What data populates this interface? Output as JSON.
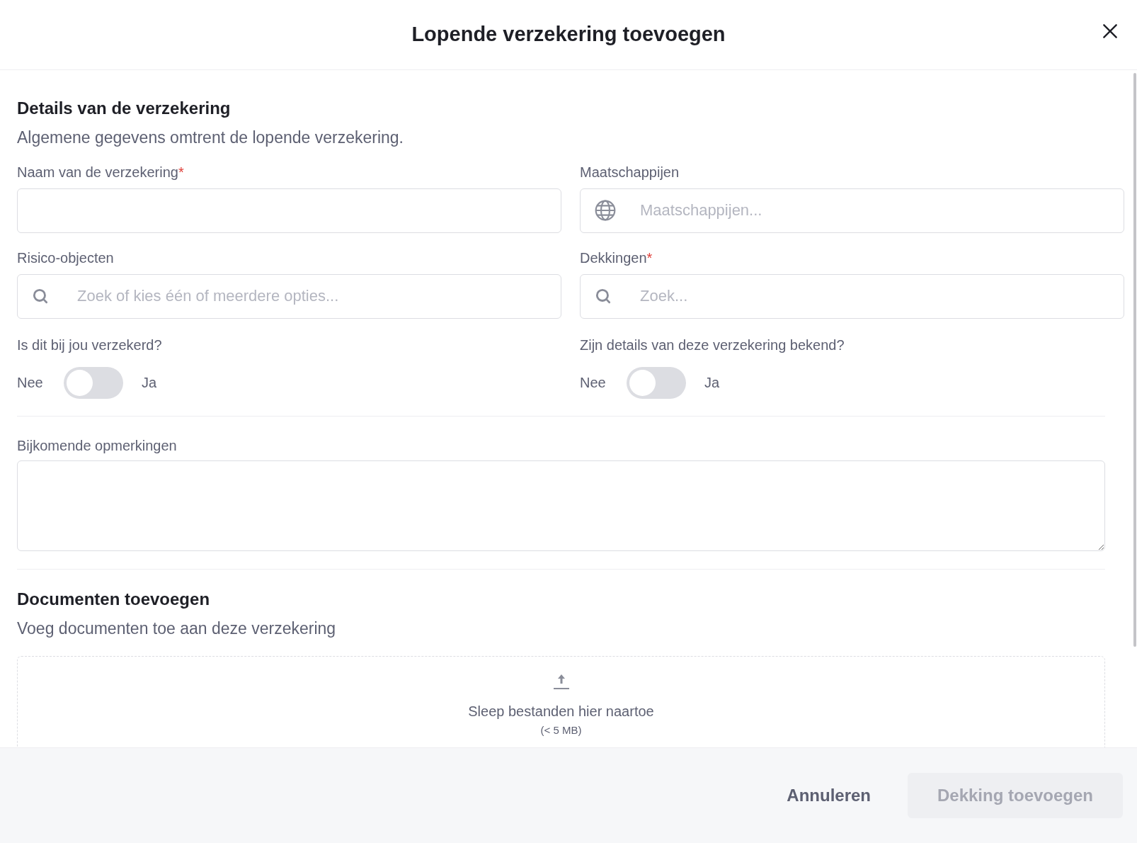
{
  "dialog": {
    "title": "Lopende verzekering toevoegen"
  },
  "details": {
    "title": "Details van de verzekering",
    "subtitle": "Algemene gegevens omtrent de lopende verzekering.",
    "fields": [
      {
        "kind": "text",
        "label": "Naam van de verzekering",
        "required_mark": "*"
      },
      {
        "kind": "globe",
        "label": "Maatschappijen",
        "placeholder": "Maatschappijen..."
      },
      {
        "kind": "search",
        "label": "Risico-objecten",
        "placeholder": "Zoek of kies één of meerdere opties..."
      },
      {
        "kind": "search",
        "label": "Dekkingen",
        "required_mark": "*",
        "placeholder": "Zoek..."
      }
    ],
    "toggles": [
      {
        "question": "Is dit bij jou verzekerd?",
        "off_label": "Nee",
        "on_label": "Ja",
        "on": false
      },
      {
        "question": "Zijn details van deze verzekering bekend?",
        "off_label": "Nee",
        "on_label": "Ja",
        "on": false
      }
    ],
    "remarks": {
      "label": "Bijkomende opmerkingen"
    }
  },
  "documents": {
    "title": "Documenten toevoegen",
    "subtitle": "Voeg documenten toe aan deze verzekering",
    "dropzone": {
      "text": "Sleep bestanden hier naartoe",
      "limit": "(< 5 MB)"
    }
  },
  "footer": {
    "cancel": "Annuleren",
    "submit": {
      "label": "Dekking toevoegen",
      "disabled": true
    }
  }
}
